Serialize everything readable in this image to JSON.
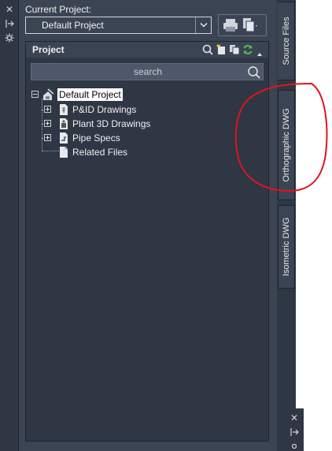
{
  "current_project": {
    "label": "Current Project:",
    "selected": "Default Project"
  },
  "project_panel": {
    "title": "Project",
    "search_placeholder": "search"
  },
  "tree": {
    "root": "Default Project",
    "children": [
      "P&ID Drawings",
      "Plant 3D Drawings",
      "Pipe Specs",
      "Related Files"
    ]
  },
  "tabs": {
    "source_files": "Source Files",
    "orthographic": "Orthographic DWG",
    "isometric": "Isometric DWG"
  },
  "colors": {
    "panel_bg": "#3b4453",
    "tree_bg": "#2f3644",
    "annotation_red": "#e0141e"
  }
}
